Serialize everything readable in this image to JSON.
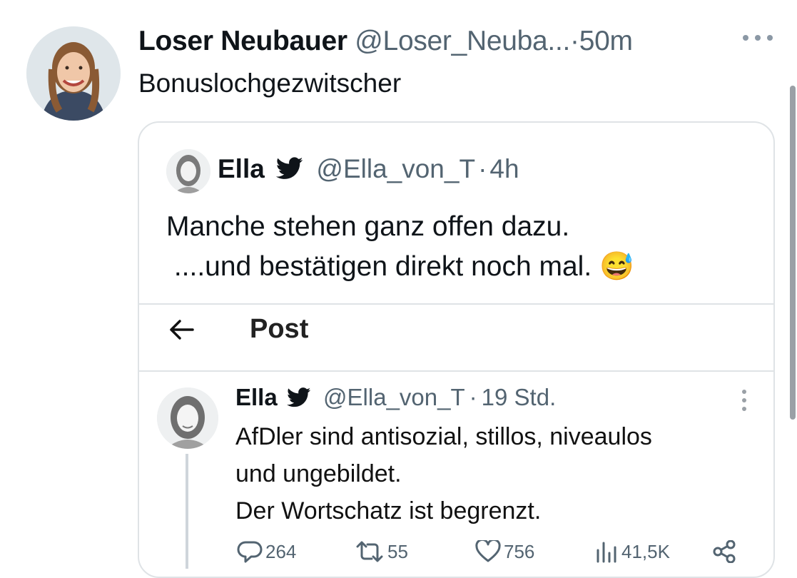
{
  "tweet": {
    "display_name": "Loser Neubauer",
    "handle": "@Loser_Neuba...",
    "separator": "·",
    "time": "50m",
    "text": "Bonuslochgezwitscher",
    "more_icon": "more-horizontal-icon"
  },
  "quoted_tweet": {
    "display_name": "Ella",
    "verified_icon": "twitter-bird-icon",
    "handle": "@Ella_von_T",
    "separator": "·",
    "time": "4h",
    "text_line1": "Manche stehen ganz offen dazu.",
    "text_line2": " ....und bestätigen direkt noch mal.",
    "emoji": "😅",
    "embedded_screenshot": {
      "header": {
        "back_icon": "arrow-left-icon",
        "title": "Post"
      },
      "post": {
        "display_name": "Ella",
        "verified_icon": "twitter-bird-icon",
        "handle": "@Ella_von_T",
        "separator": "·",
        "time": "19 Std.",
        "text_line1": "AfDler sind antisozial, stillos, niveaulos",
        "text_line2": "und ungebildet.",
        "text_line3": "Der Wortschatz ist begrenzt.",
        "actions": {
          "replies": "264",
          "reposts": "55",
          "likes": "756",
          "views": "41,5K"
        }
      }
    }
  },
  "colors": {
    "text": "#0f1419",
    "secondary": "#536471",
    "border": "#dfe3e6"
  }
}
